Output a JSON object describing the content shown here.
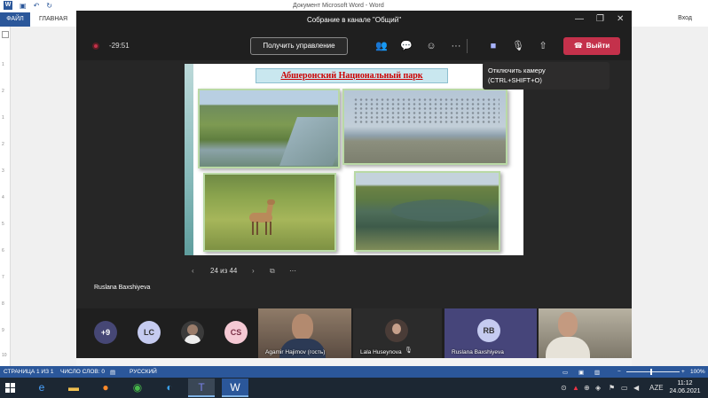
{
  "word": {
    "doc_title": "Документ Microsoft Word - Word",
    "signin": "Вход",
    "tab_file": "ФАЙЛ",
    "tab_home": "ГЛАВНАЯ",
    "ruler_numbers": [
      "1",
      "2",
      "1",
      "2",
      "3",
      "4",
      "5",
      "6",
      "7",
      "8",
      "9",
      "10",
      "11",
      "12",
      "13"
    ],
    "status": {
      "page": "СТРАНИЦА 1 ИЗ 1",
      "words": "ЧИСЛО СЛОВ: 0",
      "language": "РУССКИЙ",
      "zoom": "100%"
    }
  },
  "teams": {
    "title": "Собрание в канале \"Общий\"",
    "timer": "-29:51",
    "take_control_label": "Получить управление",
    "leave_label": "Выйти",
    "tooltip_line1": "Отключить камеру",
    "tooltip_line2": "(CTRL+SHIFT+O)",
    "slide": {
      "title": "Абшеронский Национальный парк",
      "counter": "24 из 44"
    },
    "speaker_name": "Ruslana Baxshiyeva",
    "participants": {
      "overflow": "+9",
      "lc": "LC",
      "cs": "CS",
      "rb": "RB",
      "tile1_name": "Agamir Hajimov (гость)",
      "tile2_name": "Lala Huseynova",
      "tile3_name": "Ruslana Baxshiyeva"
    }
  },
  "taskbar": {
    "language": "AZE",
    "time": "11:12",
    "date": "24.06.2021"
  },
  "colors": {
    "leave": "#c4314b",
    "word_blue": "#2b579a",
    "slide_title": "#cc0000"
  }
}
